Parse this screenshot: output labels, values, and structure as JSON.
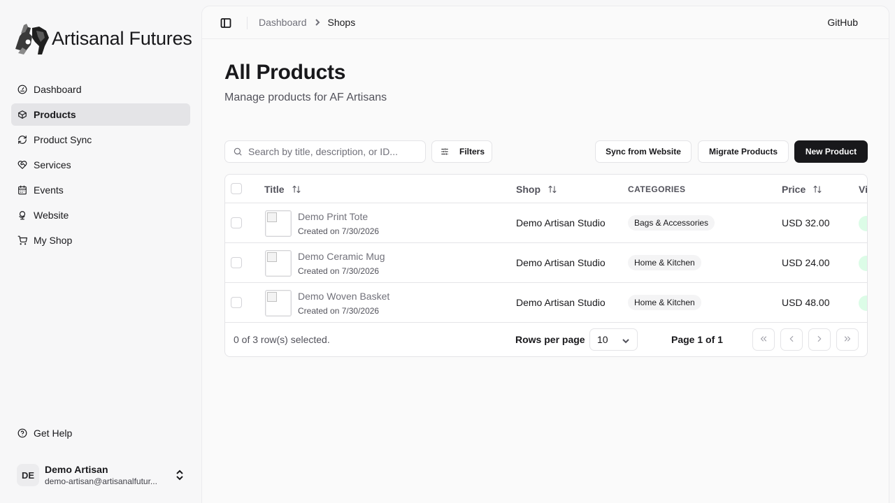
{
  "brand": {
    "name": "Artisanal Futures"
  },
  "sidebar": {
    "items": [
      {
        "label": "Dashboard",
        "icon": "dashboard-gauge-icon",
        "active": false
      },
      {
        "label": "Products",
        "icon": "package-icon",
        "active": true
      },
      {
        "label": "Product Sync",
        "icon": "refresh-icon",
        "active": false
      },
      {
        "label": "Services",
        "icon": "heart-handshake-icon",
        "active": false
      },
      {
        "label": "Events",
        "icon": "calendar-icon",
        "active": false
      },
      {
        "label": "Website",
        "icon": "globe-stand-icon",
        "active": false
      },
      {
        "label": "My Shop",
        "icon": "store-icon",
        "active": false
      }
    ],
    "help": {
      "label": "Get Help",
      "icon": "help-circle-icon"
    },
    "user": {
      "initials": "DE",
      "name": "Demo Artisan",
      "email": "demo-artisan@artisanalfutur..."
    }
  },
  "topbar": {
    "breadcrumb": {
      "parent": "Dashboard",
      "current": "Shops"
    },
    "github": "GitHub"
  },
  "page": {
    "title": "All Products",
    "subtitle": "Manage products for AF Artisans"
  },
  "toolbar": {
    "search_placeholder": "Search by title, description, or ID...",
    "filters_label": "Filters",
    "sync_label": "Sync from Website",
    "migrate_label": "Migrate Products",
    "new_label": "New Product"
  },
  "table": {
    "columns": {
      "title": "Title",
      "shop": "Shop",
      "categories": "CATEGORIES",
      "price": "Price",
      "visibility": "Vi"
    },
    "rows": [
      {
        "title": "Demo Print Tote",
        "created": "Created on 7/30/2026",
        "shop": "Demo Artisan Studio",
        "category": "Bags & Accessories",
        "price": "USD 32.00"
      },
      {
        "title": "Demo Ceramic Mug",
        "created": "Created on 7/30/2026",
        "shop": "Demo Artisan Studio",
        "category": "Home & Kitchen",
        "price": "USD 24.00"
      },
      {
        "title": "Demo Woven Basket",
        "created": "Created on 7/30/2026",
        "shop": "Demo Artisan Studio",
        "category": "Home & Kitchen",
        "price": "USD 48.00"
      }
    ],
    "footer": {
      "selection": "0 of 3 row(s) selected.",
      "rows_per_page_label": "Rows per page",
      "rows_per_page_value": "10",
      "page_info": "Page 1 of 1"
    }
  },
  "colors": {
    "accent": "#18181b",
    "active_nav": "#e4e4e7",
    "badge_bg": "#f4f4f5",
    "status_pill": "#dcfce7"
  }
}
